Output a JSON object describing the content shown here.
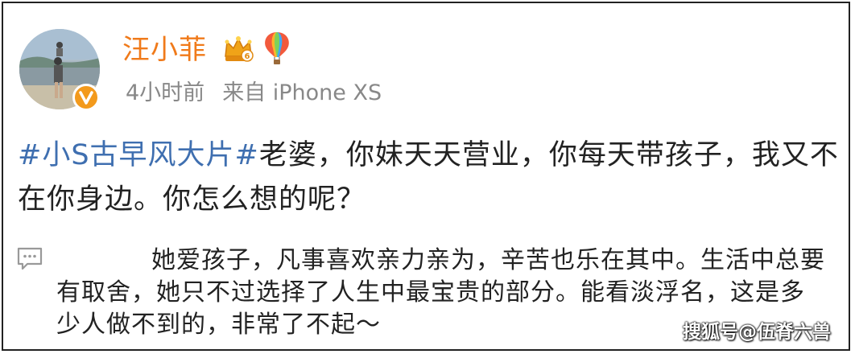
{
  "user": {
    "name": "汪小菲",
    "crown_level": "6",
    "time": "4小时前",
    "source": "来自 iPhone XS"
  },
  "post": {
    "hashtag": "#小S古早风大片#",
    "text": "老婆，你妹天天营业，你每天带孩子，我又不在你身边。你怎么想的呢？"
  },
  "comment": {
    "text": "她爱孩子，凡事喜欢亲力亲为，辛苦也乐在其中。生活中总要有取舍，她只不过选择了人生中最宝贵的部分。能看淡浮名，这是多少人做不到的，非常了不起～"
  },
  "watermark": "搜狐号@伍脊六兽",
  "icons": [
    "avatar",
    "verified-v-icon",
    "crown-icon",
    "hot-air-balloon-icon",
    "comment-icon"
  ],
  "colors": {
    "username": "#f07a1a",
    "hashtag": "#3f6fb0",
    "meta": "#888888",
    "verified": "#f39a1c"
  }
}
